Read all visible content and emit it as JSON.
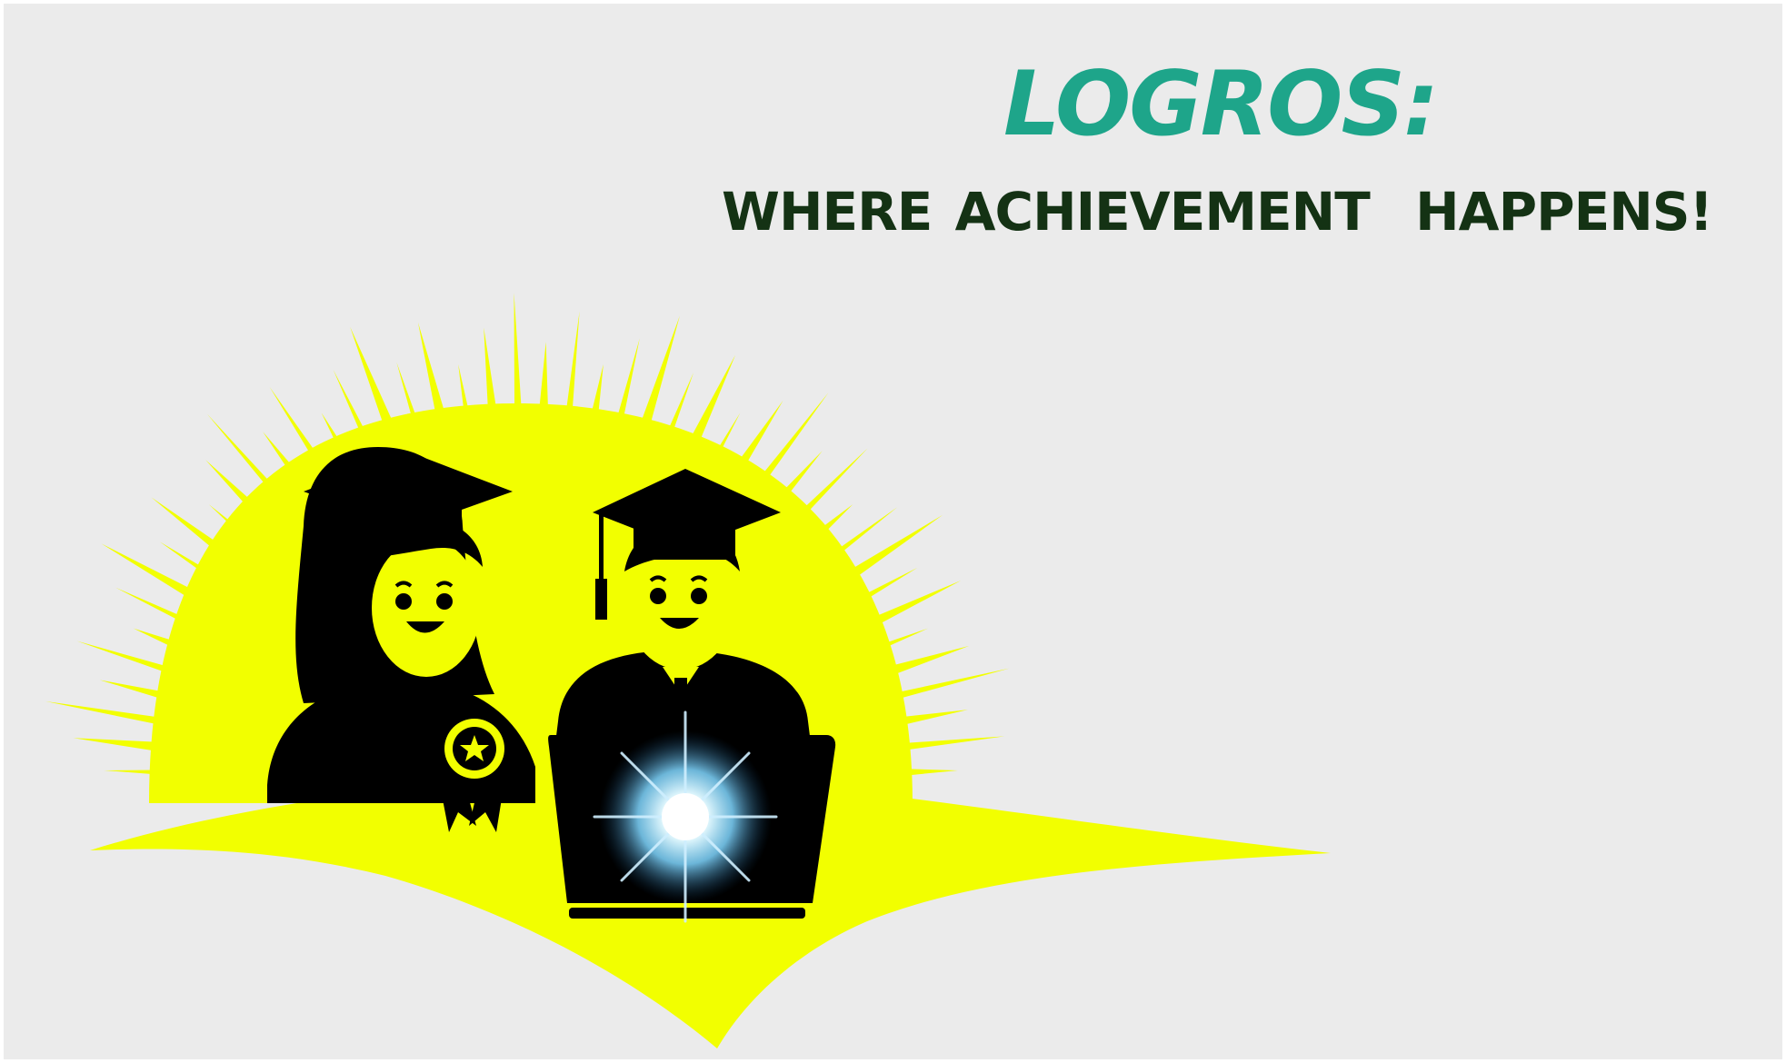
{
  "logo": {
    "title": "LOGROS:",
    "tagline": "WHERE ACHIEVEMENT  HAPPENS!",
    "illustration": {
      "icons": [
        "sunburst-icon",
        "female-graduate-icon",
        "male-graduate-icon",
        "award-ribbon-icon",
        "laptop-icon",
        "glowing-star-icon"
      ]
    }
  },
  "colors": {
    "background": "#ebebeb",
    "title": "#1ea58a",
    "tagline": "#143214",
    "sun": "#f2ff00",
    "figures": "#000000",
    "glow": "#7fd6ff"
  }
}
